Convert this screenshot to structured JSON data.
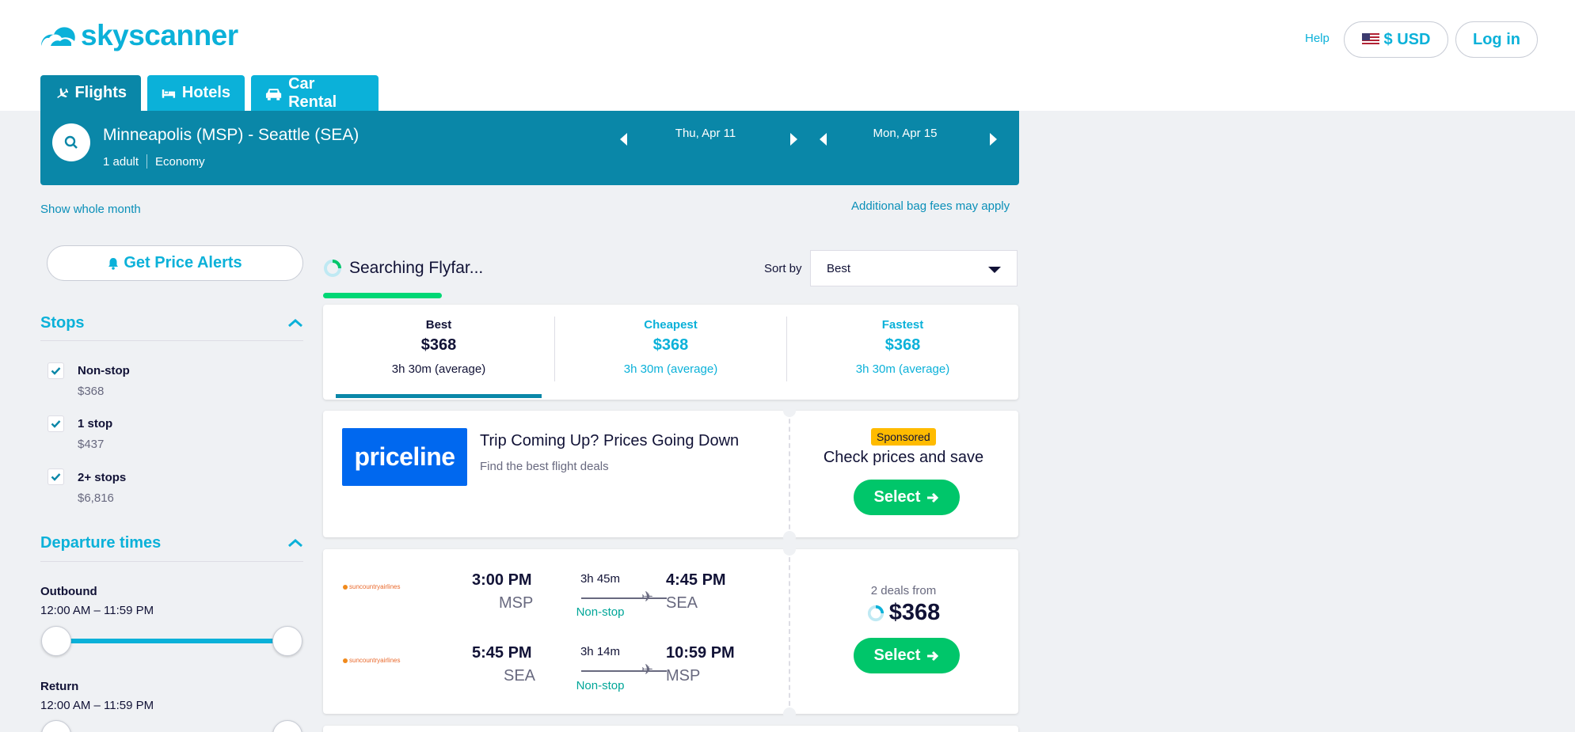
{
  "brand": {
    "name": "skyscanner",
    "color": "#0bb1d9"
  },
  "header": {
    "help": "Help",
    "currency": "$ USD",
    "login": "Log in"
  },
  "tabs": [
    {
      "label": "Flights",
      "icon": "plane-icon",
      "active": true
    },
    {
      "label": "Hotels",
      "icon": "bed-icon",
      "active": false
    },
    {
      "label": "Car Rental",
      "icon": "car-icon",
      "active": false
    }
  ],
  "search": {
    "route": "Minneapolis (MSP) - Seattle (SEA)",
    "travellers": "1 adult",
    "cabin": "Economy",
    "depart_date": "Thu, Apr 11",
    "return_date": "Mon, Apr 15"
  },
  "links": {
    "whole_month": "Show whole month",
    "bag_fees": "Additional bag fees may apply"
  },
  "filters": {
    "alerts": "Get Price Alerts",
    "stops": {
      "title": "Stops",
      "options": [
        {
          "label": "Non-stop",
          "price": "$368",
          "checked": true
        },
        {
          "label": "1 stop",
          "price": "$437",
          "checked": true
        },
        {
          "label": "2+ stops",
          "price": "$6,816",
          "checked": true
        }
      ]
    },
    "departure_times": {
      "title": "Departure times",
      "outbound_label": "Outbound",
      "outbound_range": "12:00 AM – 11:59 PM",
      "return_label": "Return",
      "return_range": "12:00 AM – 11:59 PM"
    }
  },
  "results": {
    "searching": "Searching Flyfar...",
    "sort_label": "Sort by",
    "sort_value": "Best",
    "sort_tabs": [
      {
        "label": "Best",
        "price": "$368",
        "duration": "3h 30m (average)",
        "active": true
      },
      {
        "label": "Cheapest",
        "price": "$368",
        "duration": "3h 30m (average)",
        "active": false
      },
      {
        "label": "Fastest",
        "price": "$368",
        "duration": "3h 30m (average)",
        "active": false
      }
    ],
    "ad": {
      "logo_text": "priceline",
      "title": "Trip Coming Up? Prices Going Down",
      "subtitle": "Find the best flight deals",
      "badge": "Sponsored",
      "cta_text": "Check prices and save",
      "button": "Select"
    },
    "itinerary": {
      "legs": [
        {
          "airline": "suncountryairlines",
          "dep_time": "3:00 PM",
          "dep_airport": "MSP",
          "duration": "3h 45m",
          "stops": "Non-stop",
          "arr_time": "4:45 PM",
          "arr_airport": "SEA"
        },
        {
          "airline": "suncountryairlines",
          "dep_time": "5:45 PM",
          "dep_airport": "SEA",
          "duration": "3h 14m",
          "stops": "Non-stop",
          "arr_time": "10:59 PM",
          "arr_airport": "MSP"
        }
      ],
      "deals_from": "2 deals from",
      "price": "$368",
      "button": "Select"
    }
  },
  "colors": {
    "panel": "#0a87a8",
    "accent": "#0bb1d9",
    "select_green": "#00c66a",
    "progress": "#00d775",
    "sponsored": "#ffbb00",
    "priceline": "#0068ef"
  }
}
